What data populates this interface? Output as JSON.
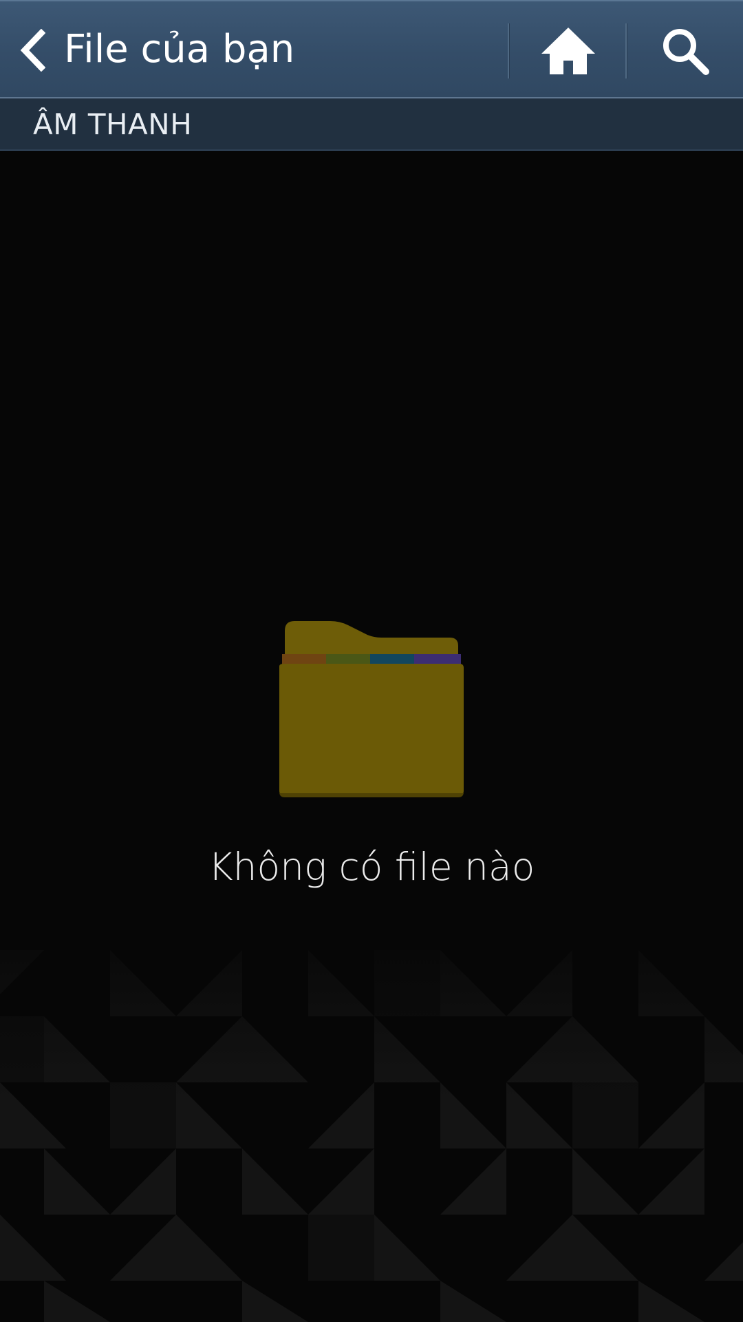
{
  "action_bar": {
    "title": "File của bạn",
    "background": "#344d68",
    "icons": {
      "back": "chevron-left-icon",
      "home": "home-icon",
      "search": "search-icon"
    }
  },
  "sub_header": {
    "title": "ÂM THANH",
    "background": "#213040"
  },
  "empty_state": {
    "message": "Không có file nào",
    "icon": "folder-icon",
    "folder_color": "#6b5a06",
    "tab_colors": [
      "#6f4412",
      "#4a5716",
      "#12465e",
      "#3c2d72"
    ]
  }
}
